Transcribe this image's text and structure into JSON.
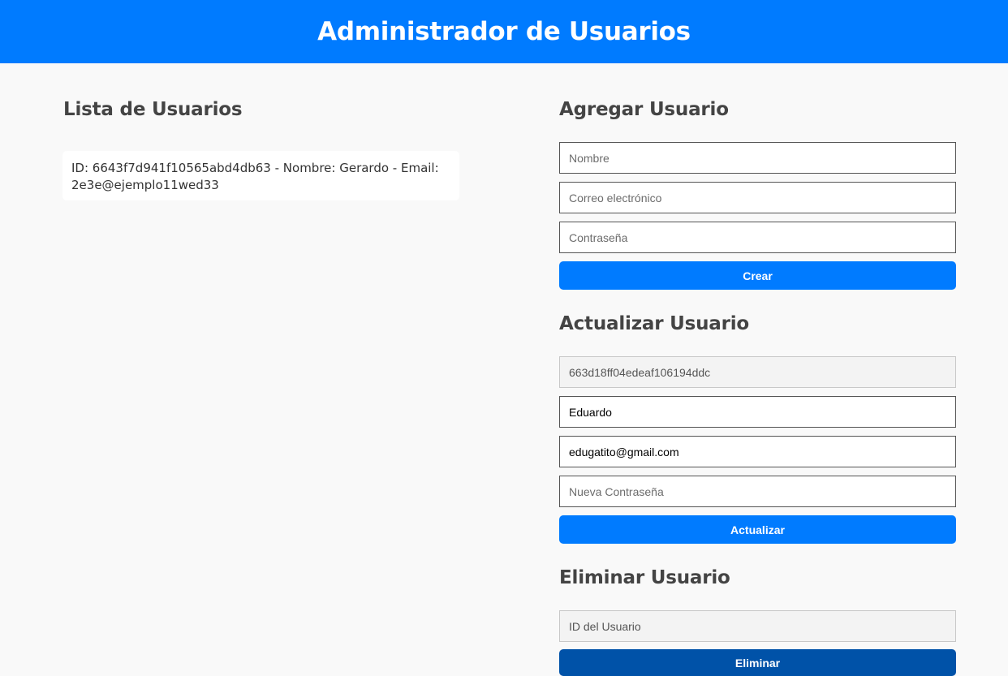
{
  "header": {
    "title": "Administrador de Usuarios"
  },
  "list": {
    "title": "Lista de Usuarios",
    "items": [
      {
        "text": "ID: 6643f7d941f10565abd4db63 - Nombre: Gerardo - Email: 2e3e@ejemplo11wed33"
      }
    ]
  },
  "add": {
    "title": "Agregar Usuario",
    "name_placeholder": "Nombre",
    "email_placeholder": "Correo electrónico",
    "password_placeholder": "Contraseña",
    "button_label": "Crear"
  },
  "update": {
    "title": "Actualizar Usuario",
    "id_value": "663d18ff04edeaf106194ddc",
    "name_value": "Eduardo",
    "email_value": "edugatito@gmail.com",
    "password_placeholder": "Nueva Contraseña",
    "button_label": "Actualizar"
  },
  "delete": {
    "title": "Eliminar Usuario",
    "id_placeholder": "ID del Usuario",
    "button_label": "Eliminar"
  },
  "colors": {
    "primary": "#007bff",
    "danger_dark": "#0052a8",
    "background": "#f9f9f9"
  }
}
